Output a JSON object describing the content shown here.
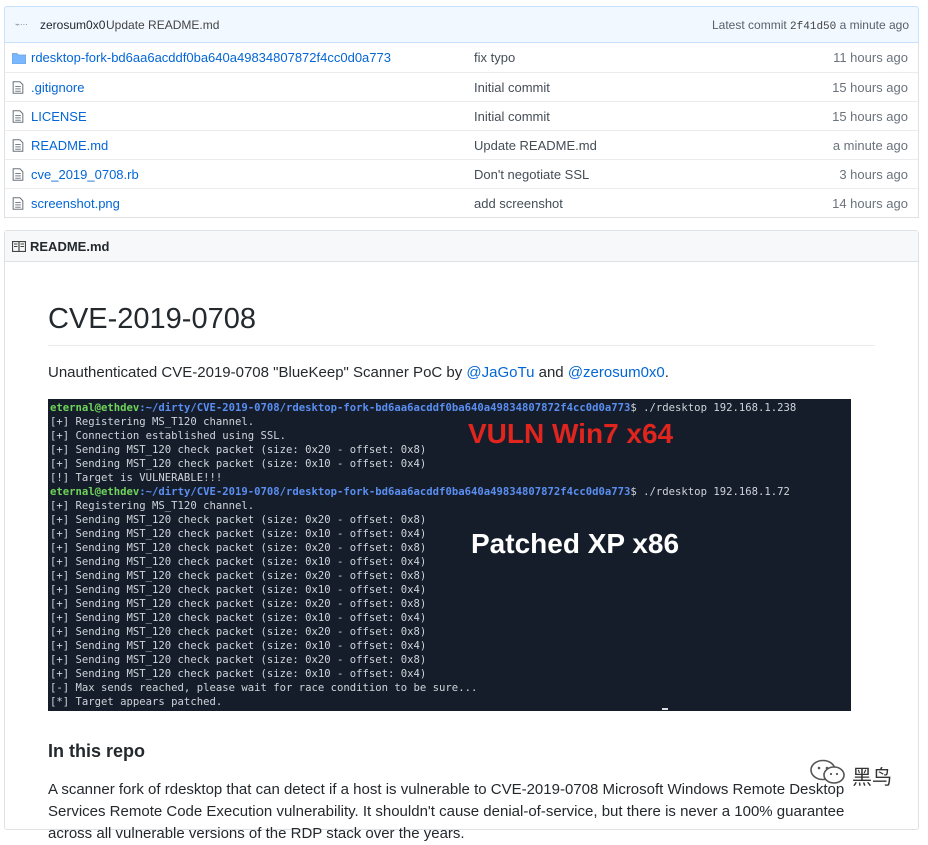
{
  "commit": {
    "author": "zerosum0x0",
    "message": "Update README.md",
    "latest_label": "Latest commit",
    "sha": "2f41d50",
    "age": "a minute ago"
  },
  "files": [
    {
      "type": "folder",
      "name": "rdesktop-fork-bd6aa6acddf0ba640a49834807872f4cc0d0a773",
      "message": "fix typo",
      "age": "11 hours ago"
    },
    {
      "type": "file",
      "name": ".gitignore",
      "message": "Initial commit",
      "age": "15 hours ago"
    },
    {
      "type": "file",
      "name": "LICENSE",
      "message": "Initial commit",
      "age": "15 hours ago"
    },
    {
      "type": "file",
      "name": "README.md",
      "message": "Update README.md",
      "age": "a minute ago"
    },
    {
      "type": "file",
      "name": "cve_2019_0708.rb",
      "message": "Don't negotiate SSL",
      "age": "3 hours ago"
    },
    {
      "type": "file",
      "name": "screenshot.png",
      "message": "add screenshot",
      "age": "14 hours ago"
    }
  ],
  "readme": {
    "header": "README.md",
    "title": "CVE-2019-0708",
    "intro_prefix": "Unauthenticated CVE-2019-0708 \"BlueKeep\" Scanner PoC by ",
    "author1": "@JaGoTu",
    "intro_and": " and ",
    "author2": "@zerosum0x0",
    "intro_suffix": ".",
    "subheading": "In this repo",
    "paragraph": "A scanner fork of rdesktop that can detect if a host is vulnerable to CVE-2019-0708 Microsoft Windows Remote Desktop Services Remote Code Execution vulnerability. It shouldn't cause denial-of-service, but there is never a 100% guarantee across all vulnerable versions of the RDP stack over the years."
  },
  "terminal": {
    "prompt_user": "eternal@ethdev",
    "prompt_path": ":~/dirty/CVE-2019-0708/rdesktop-fork-bd6aa6acddf0ba640a49834807872f4cc0d0a773",
    "cmd1": "$ ./rdesktop 192.168.1.238",
    "cmd2": "$ ./rdesktop 192.168.1.72",
    "block1": [
      "[+] Registering MS_T120 channel.",
      "[+] Connection established using SSL.",
      "[+] Sending MST_120 check packet (size: 0x20 - offset: 0x8)",
      "[+] Sending MST_120 check packet (size: 0x10 - offset: 0x4)",
      "[!] Target is VULNERABLE!!!"
    ],
    "block2": [
      "[+] Registering MS_T120 channel.",
      "[+] Sending MST_120 check packet (size: 0x20 - offset: 0x8)",
      "[+] Sending MST_120 check packet (size: 0x10 - offset: 0x4)",
      "[+] Sending MST_120 check packet (size: 0x20 - offset: 0x8)",
      "[+] Sending MST_120 check packet (size: 0x10 - offset: 0x4)",
      "[+] Sending MST_120 check packet (size: 0x20 - offset: 0x8)",
      "[+] Sending MST_120 check packet (size: 0x10 - offset: 0x4)",
      "[+] Sending MST_120 check packet (size: 0x20 - offset: 0x8)",
      "[+] Sending MST_120 check packet (size: 0x10 - offset: 0x4)",
      "[+] Sending MST_120 check packet (size: 0x20 - offset: 0x8)",
      "[+] Sending MST_120 check packet (size: 0x10 - offset: 0x4)",
      "[+] Sending MST_120 check packet (size: 0x20 - offset: 0x8)",
      "[+] Sending MST_120 check packet (size: 0x10 - offset: 0x4)",
      "[-] Max sends reached, please wait for race condition to be sure...",
      "[*] Target appears patched."
    ],
    "label_vuln": "VULN Win7 x64",
    "label_patched": "Patched XP x86",
    "vuln_color": "#e0251f",
    "patched_color": "#ffffff"
  },
  "watermark": {
    "text": "黑鸟"
  },
  "colors": {
    "link": "#0366d6",
    "commit_bar_bg": "#f1f8ff",
    "terminal_bg": "#151d2b"
  },
  "icons": {
    "folder": "folder-icon",
    "file": "file-icon",
    "book": "book-icon"
  }
}
